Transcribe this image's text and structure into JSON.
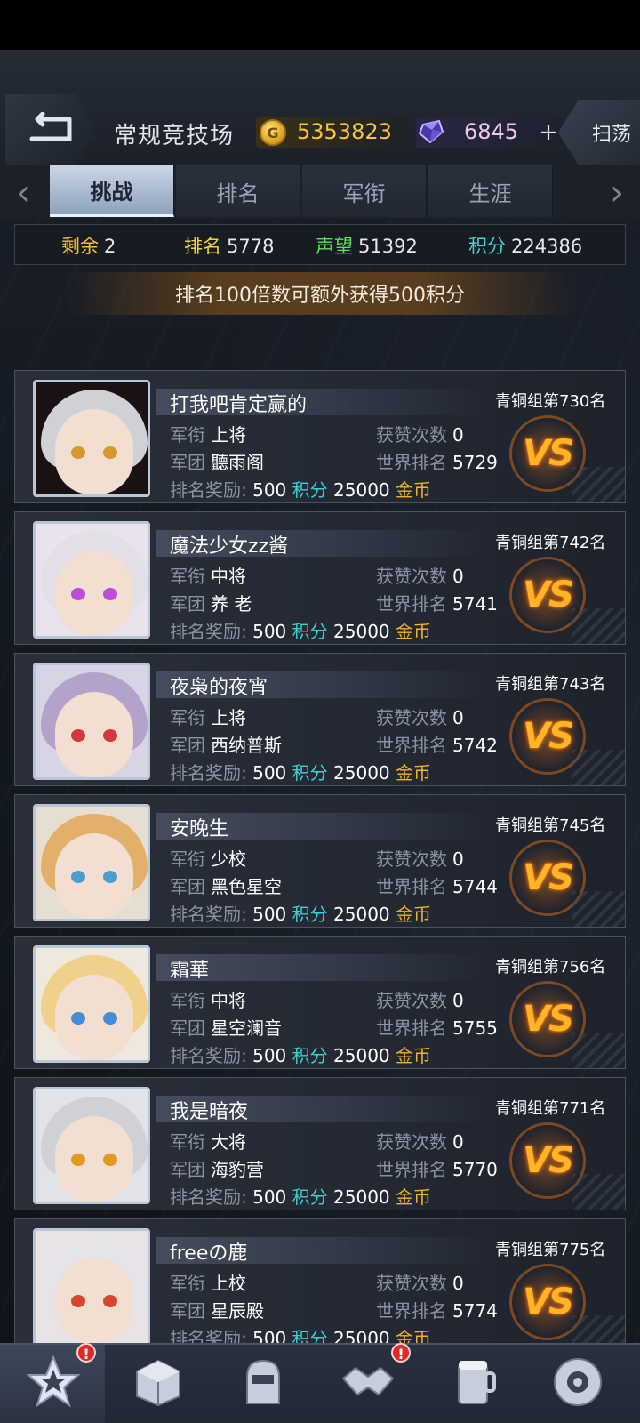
{
  "header": {
    "title": "常规竞技场",
    "gold": "5353823",
    "gems": "6845",
    "plus": "+",
    "sweep": "扫荡"
  },
  "tabs": [
    {
      "label": "挑战",
      "active": true
    },
    {
      "label": "排名",
      "active": false
    },
    {
      "label": "军衔",
      "active": false
    },
    {
      "label": "生涯",
      "active": false
    }
  ],
  "stats": {
    "remaining_label": "剩余",
    "remaining": "2",
    "rank_label": "排名",
    "rank": "5778",
    "prestige_label": "声望",
    "prestige": "51392",
    "points_label": "积分",
    "points": "224386"
  },
  "banner": "排名100倍数可额外获得500积分",
  "labels": {
    "rank_title": "军衔",
    "legion": "军团",
    "likes": "获赞次数",
    "world_rank": "世界排名",
    "reward": "排名奖励:",
    "points_unit": "积分",
    "gold_unit": "金币",
    "vs": "VS"
  },
  "opponents": [
    {
      "name": "打我吧肯定赢的",
      "group_rank": "青铜组第730名",
      "rank_title": "上将",
      "legion": "聽雨阁",
      "likes": "0",
      "world_rank": "5729",
      "reward_points": "500",
      "reward_gold": "25000"
    },
    {
      "name": "魔法少女zz酱",
      "group_rank": "青铜组第742名",
      "rank_title": "中将",
      "legion": "养 老",
      "likes": "0",
      "world_rank": "5741",
      "reward_points": "500",
      "reward_gold": "25000"
    },
    {
      "name": "夜枭的夜宵",
      "group_rank": "青铜组第743名",
      "rank_title": "上将",
      "legion": "西纳普斯",
      "likes": "0",
      "world_rank": "5742",
      "reward_points": "500",
      "reward_gold": "25000"
    },
    {
      "name": "安晚生",
      "group_rank": "青铜组第745名",
      "rank_title": "少校",
      "legion": "黑色星空",
      "likes": "0",
      "world_rank": "5744",
      "reward_points": "500",
      "reward_gold": "25000"
    },
    {
      "name": "霜華",
      "group_rank": "青铜组第756名",
      "rank_title": "中将",
      "legion": "星空澜音",
      "likes": "0",
      "world_rank": "5755",
      "reward_points": "500",
      "reward_gold": "25000"
    },
    {
      "name": "我是暗夜",
      "group_rank": "青铜组第771名",
      "rank_title": "大将",
      "legion": "海豹营",
      "likes": "0",
      "world_rank": "5770",
      "reward_points": "500",
      "reward_gold": "25000"
    },
    {
      "name": "freeの鹿",
      "group_rank": "青铜组第775名",
      "rank_title": "上校",
      "legion": "星辰殿",
      "likes": "0",
      "world_rank": "5774",
      "reward_points": "500",
      "reward_gold": "25000"
    }
  ],
  "nav": [
    {
      "label": "基地",
      "icon": "base-icon",
      "active": true,
      "badge": "!"
    },
    {
      "label": "仓库",
      "icon": "warehouse-icon",
      "active": false
    },
    {
      "label": "编队",
      "icon": "formation-icon",
      "active": false
    },
    {
      "label": "社交",
      "icon": "handshake-icon",
      "active": false,
      "badge": "!"
    },
    {
      "label": "吧台",
      "icon": "bar-icon",
      "active": false
    },
    {
      "label": "商城",
      "icon": "shop-icon",
      "active": false
    }
  ],
  "colors": {
    "gold_text": "#f5c544",
    "gem_text": "#f2c8ef",
    "remaining": "#f1c232",
    "rank": "#f2d33a",
    "prestige": "#58e35a",
    "points": "#3ed6d9",
    "vs": "#ffb326"
  }
}
